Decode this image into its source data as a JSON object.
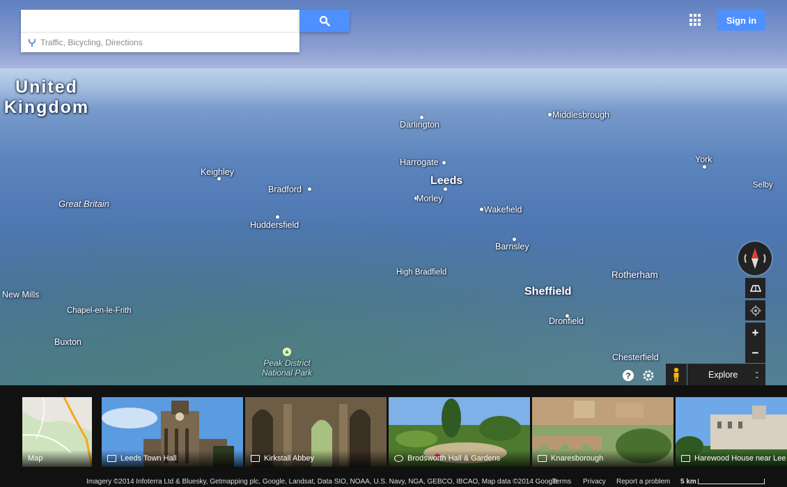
{
  "search": {
    "placeholder": "",
    "suggestion": "Traffic, Bicycling, Directions"
  },
  "header": {
    "signin_label": "Sign in"
  },
  "map": {
    "view": "3D aerial terrain",
    "country": [
      "United",
      "Kingdom"
    ],
    "places": [
      {
        "name": "Darlington"
      },
      {
        "name": "Middlesbrough"
      },
      {
        "name": "Harrogate"
      },
      {
        "name": "Leeds"
      },
      {
        "name": "York"
      },
      {
        "name": "Selby"
      },
      {
        "name": "Keighley"
      },
      {
        "name": "Bradford"
      },
      {
        "name": "Morley"
      },
      {
        "name": "Wakefield"
      },
      {
        "name": "Great Britain"
      },
      {
        "name": "Huddersfield"
      },
      {
        "name": "Barnsley"
      },
      {
        "name": "High Bradfield"
      },
      {
        "name": "Rotherham"
      },
      {
        "name": "Sheffield"
      },
      {
        "name": "New Mills"
      },
      {
        "name": "Chapel-en-le-Frith"
      },
      {
        "name": "Dronfield"
      },
      {
        "name": "Buxton"
      },
      {
        "name": "Peak District National Park"
      },
      {
        "name": "Chesterfield"
      }
    ]
  },
  "controls": {
    "zoom_in": "+",
    "zoom_out": "−",
    "explore_label": "Explore",
    "icons": [
      "compass-icon",
      "tilt-icon",
      "my-location-icon",
      "help-icon",
      "settings-icon",
      "pegman-icon"
    ]
  },
  "carousel": {
    "items": [
      {
        "label": "Map",
        "icon": "none"
      },
      {
        "label": "Leeds Town Hall",
        "icon": "photo-sphere-icon"
      },
      {
        "label": "Kirkstall Abbey",
        "icon": "photo-sphere-icon"
      },
      {
        "label": "Brodsworth Hall & Gardens",
        "icon": "360-icon"
      },
      {
        "label": "Knaresborough",
        "icon": "photo-sphere-icon"
      },
      {
        "label": "Harewood House near Lee",
        "icon": "camera-icon"
      }
    ]
  },
  "footer": {
    "attribution": "Imagery ©2014 Infoterra Ltd & Bluesky, Getmapping plc, Google, Landsat, Data SIO, NOAA, U.S. Navy, NGA, GEBCO, IBCAO, Map data ©2014 Google",
    "terms": "Terms",
    "privacy": "Privacy",
    "report": "Report a problem",
    "scale": "5 km"
  },
  "colors": {
    "accent": "#4d90fe",
    "control_bg": "#222222"
  }
}
